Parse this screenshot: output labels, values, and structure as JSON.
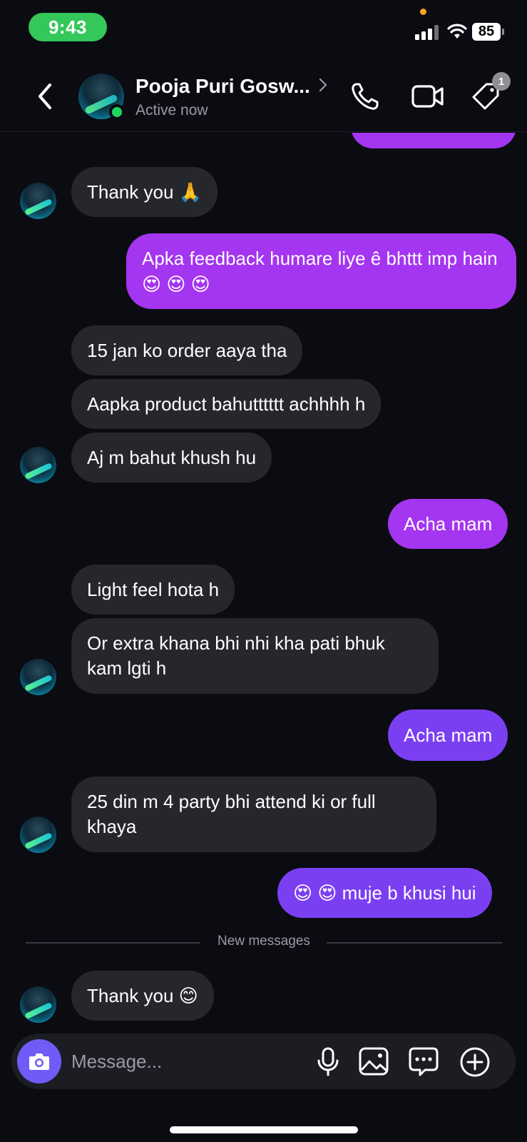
{
  "status_bar": {
    "time": "9:43",
    "battery": "85"
  },
  "header": {
    "name": "Pooja Puri Gosw...",
    "status": "Active now",
    "tag_badge": "1"
  },
  "messages": [
    {
      "side": "out",
      "text": "",
      "partial": true
    },
    {
      "side": "in",
      "text": "Thank you 🙏"
    },
    {
      "side": "out",
      "text": "Apka feedback humare liye ê bhttt imp hain😍 😍 😍"
    },
    {
      "side": "in",
      "text": "15 jan ko order aaya tha"
    },
    {
      "side": "in",
      "text": "Aapka product bahutttttt achhhh h"
    },
    {
      "side": "in",
      "text": "Aj m bahut khush hu"
    },
    {
      "side": "out",
      "text": "Acha mam"
    },
    {
      "side": "in",
      "text": "Light feel hota h"
    },
    {
      "side": "in",
      "text": "Or extra khana bhi nhi kha pati bhuk kam lgti h"
    },
    {
      "side": "out",
      "text": "Acha mam"
    },
    {
      "side": "in",
      "text": "25 din m 4 party bhi attend ki or full khaya"
    },
    {
      "side": "out",
      "text": "😍 😍 muje b khusi hui"
    },
    {
      "side": "in",
      "text": "Thank you 😊"
    }
  ],
  "divider": {
    "label": "New messages"
  },
  "composer": {
    "placeholder": "Message..."
  },
  "colors": {
    "bubble_in": "#26272d",
    "bubble_out_purple": "#a435f0",
    "bubble_out_violet": "#7b3ff2",
    "online": "#1ed760",
    "camera": "#6f5cf6"
  },
  "icons": [
    "back-icon",
    "chevron-right-icon",
    "phone-icon",
    "video-camera-icon",
    "tag-icon",
    "camera-icon",
    "microphone-icon",
    "gallery-icon",
    "sticker-icon",
    "plus-circle-icon"
  ]
}
